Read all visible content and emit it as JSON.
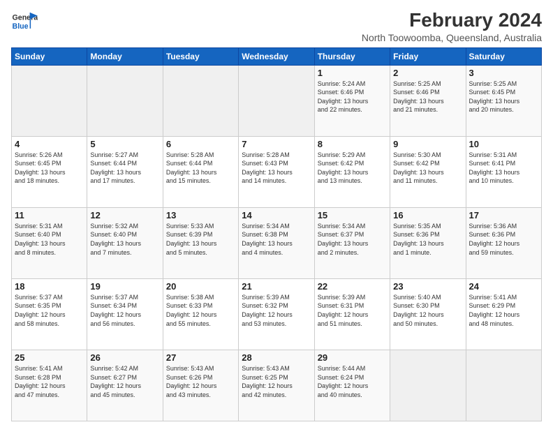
{
  "header": {
    "month_year": "February 2024",
    "location": "North Toowoomba, Queensland, Australia"
  },
  "days_of_week": [
    "Sunday",
    "Monday",
    "Tuesday",
    "Wednesday",
    "Thursday",
    "Friday",
    "Saturday"
  ],
  "weeks": [
    [
      {
        "num": "",
        "info": ""
      },
      {
        "num": "",
        "info": ""
      },
      {
        "num": "",
        "info": ""
      },
      {
        "num": "",
        "info": ""
      },
      {
        "num": "1",
        "info": "Sunrise: 5:24 AM\nSunset: 6:46 PM\nDaylight: 13 hours\nand 22 minutes."
      },
      {
        "num": "2",
        "info": "Sunrise: 5:25 AM\nSunset: 6:46 PM\nDaylight: 13 hours\nand 21 minutes."
      },
      {
        "num": "3",
        "info": "Sunrise: 5:25 AM\nSunset: 6:45 PM\nDaylight: 13 hours\nand 20 minutes."
      }
    ],
    [
      {
        "num": "4",
        "info": "Sunrise: 5:26 AM\nSunset: 6:45 PM\nDaylight: 13 hours\nand 18 minutes."
      },
      {
        "num": "5",
        "info": "Sunrise: 5:27 AM\nSunset: 6:44 PM\nDaylight: 13 hours\nand 17 minutes."
      },
      {
        "num": "6",
        "info": "Sunrise: 5:28 AM\nSunset: 6:44 PM\nDaylight: 13 hours\nand 15 minutes."
      },
      {
        "num": "7",
        "info": "Sunrise: 5:28 AM\nSunset: 6:43 PM\nDaylight: 13 hours\nand 14 minutes."
      },
      {
        "num": "8",
        "info": "Sunrise: 5:29 AM\nSunset: 6:42 PM\nDaylight: 13 hours\nand 13 minutes."
      },
      {
        "num": "9",
        "info": "Sunrise: 5:30 AM\nSunset: 6:42 PM\nDaylight: 13 hours\nand 11 minutes."
      },
      {
        "num": "10",
        "info": "Sunrise: 5:31 AM\nSunset: 6:41 PM\nDaylight: 13 hours\nand 10 minutes."
      }
    ],
    [
      {
        "num": "11",
        "info": "Sunrise: 5:31 AM\nSunset: 6:40 PM\nDaylight: 13 hours\nand 8 minutes."
      },
      {
        "num": "12",
        "info": "Sunrise: 5:32 AM\nSunset: 6:40 PM\nDaylight: 13 hours\nand 7 minutes."
      },
      {
        "num": "13",
        "info": "Sunrise: 5:33 AM\nSunset: 6:39 PM\nDaylight: 13 hours\nand 5 minutes."
      },
      {
        "num": "14",
        "info": "Sunrise: 5:34 AM\nSunset: 6:38 PM\nDaylight: 13 hours\nand 4 minutes."
      },
      {
        "num": "15",
        "info": "Sunrise: 5:34 AM\nSunset: 6:37 PM\nDaylight: 13 hours\nand 2 minutes."
      },
      {
        "num": "16",
        "info": "Sunrise: 5:35 AM\nSunset: 6:36 PM\nDaylight: 13 hours\nand 1 minute."
      },
      {
        "num": "17",
        "info": "Sunrise: 5:36 AM\nSunset: 6:36 PM\nDaylight: 12 hours\nand 59 minutes."
      }
    ],
    [
      {
        "num": "18",
        "info": "Sunrise: 5:37 AM\nSunset: 6:35 PM\nDaylight: 12 hours\nand 58 minutes."
      },
      {
        "num": "19",
        "info": "Sunrise: 5:37 AM\nSunset: 6:34 PM\nDaylight: 12 hours\nand 56 minutes."
      },
      {
        "num": "20",
        "info": "Sunrise: 5:38 AM\nSunset: 6:33 PM\nDaylight: 12 hours\nand 55 minutes."
      },
      {
        "num": "21",
        "info": "Sunrise: 5:39 AM\nSunset: 6:32 PM\nDaylight: 12 hours\nand 53 minutes."
      },
      {
        "num": "22",
        "info": "Sunrise: 5:39 AM\nSunset: 6:31 PM\nDaylight: 12 hours\nand 51 minutes."
      },
      {
        "num": "23",
        "info": "Sunrise: 5:40 AM\nSunset: 6:30 PM\nDaylight: 12 hours\nand 50 minutes."
      },
      {
        "num": "24",
        "info": "Sunrise: 5:41 AM\nSunset: 6:29 PM\nDaylight: 12 hours\nand 48 minutes."
      }
    ],
    [
      {
        "num": "25",
        "info": "Sunrise: 5:41 AM\nSunset: 6:28 PM\nDaylight: 12 hours\nand 47 minutes."
      },
      {
        "num": "26",
        "info": "Sunrise: 5:42 AM\nSunset: 6:27 PM\nDaylight: 12 hours\nand 45 minutes."
      },
      {
        "num": "27",
        "info": "Sunrise: 5:43 AM\nSunset: 6:26 PM\nDaylight: 12 hours\nand 43 minutes."
      },
      {
        "num": "28",
        "info": "Sunrise: 5:43 AM\nSunset: 6:25 PM\nDaylight: 12 hours\nand 42 minutes."
      },
      {
        "num": "29",
        "info": "Sunrise: 5:44 AM\nSunset: 6:24 PM\nDaylight: 12 hours\nand 40 minutes."
      },
      {
        "num": "",
        "info": ""
      },
      {
        "num": "",
        "info": ""
      }
    ]
  ]
}
